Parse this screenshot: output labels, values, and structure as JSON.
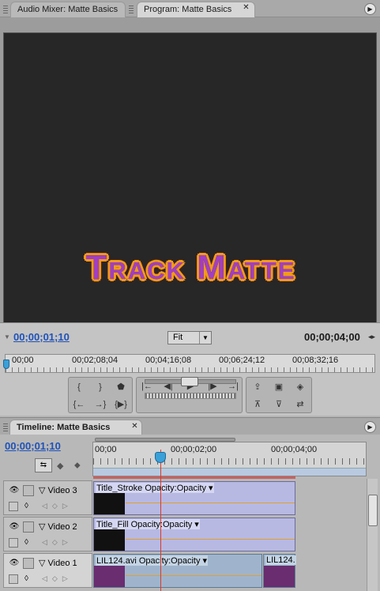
{
  "top_tabs": [
    {
      "label": "Audio Mixer: Matte Basics"
    },
    {
      "label": "Program: Matte Basics"
    }
  ],
  "viewer": {
    "title_text": "Track Matte"
  },
  "program_controls": {
    "current_time": "00;00;01;10",
    "duration": "00;00;04;00",
    "zoom_select": "Fit",
    "ruler_labels": [
      "00;00",
      "00;02;08;04",
      "00;04;16;08",
      "00;06;24;12",
      "00;08;32;16"
    ]
  },
  "timeline": {
    "tab_label": "Timeline: Matte Basics",
    "current_time": "00;00;01;10",
    "ruler_labels": [
      "00;00",
      "00;00;02;00",
      "00;00;04;00"
    ],
    "tracks": [
      {
        "name": "Video 3",
        "clips": [
          {
            "label": "Title_Stroke",
            "effect": "Opacity:Opacity ▾"
          }
        ]
      },
      {
        "name": "Video 2",
        "clips": [
          {
            "label": "Title_Fill",
            "effect": "Opacity:Opacity ▾"
          }
        ]
      },
      {
        "name": "Video 1",
        "clips": [
          {
            "label": "LIL124.avi",
            "effect": "Opacity:Opacity ▾"
          },
          {
            "label": "LIL124."
          }
        ]
      }
    ]
  }
}
